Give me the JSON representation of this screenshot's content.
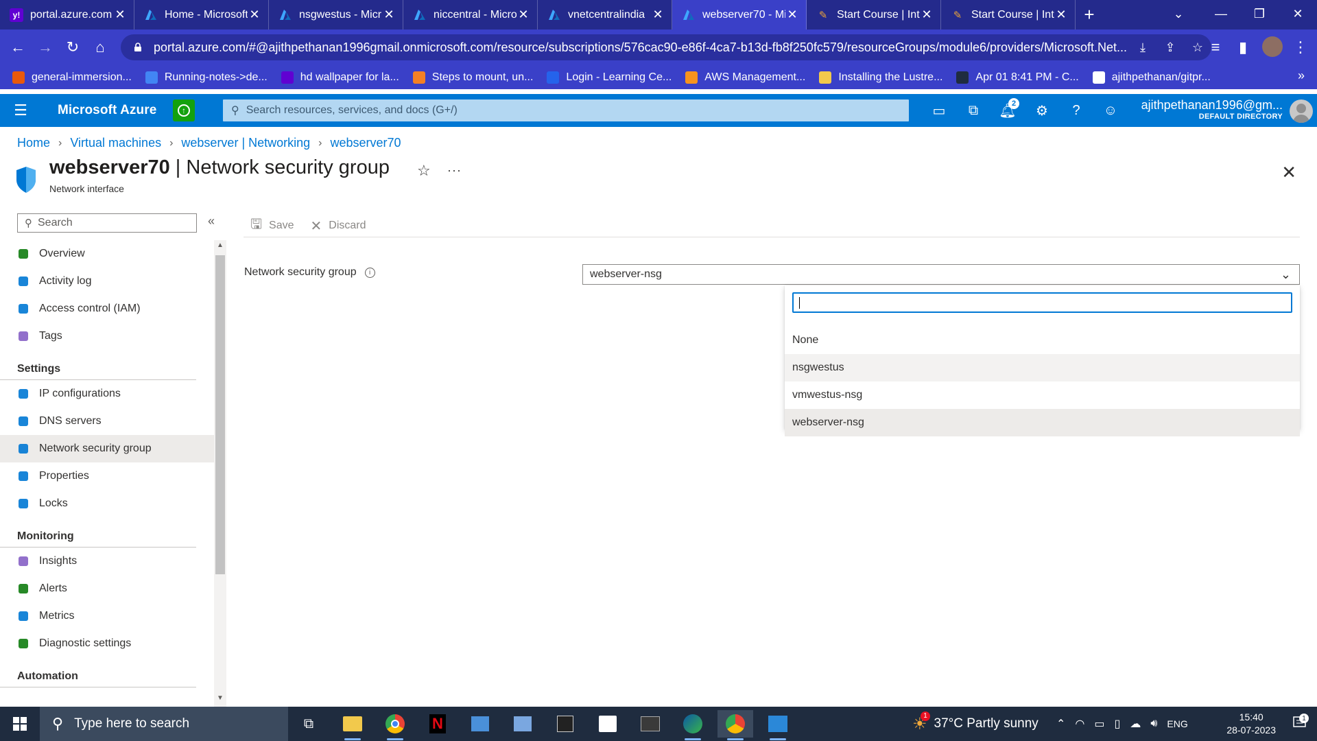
{
  "browser": {
    "tabs": [
      {
        "title": "portal.azure.com",
        "icon": "yahoo-icon",
        "active": false
      },
      {
        "title": "Home - Microsoft",
        "icon": "azure-icon",
        "active": false
      },
      {
        "title": "nsgwestus - Micr",
        "icon": "azure-icon",
        "active": false
      },
      {
        "title": "niccentral - Micro",
        "icon": "azure-icon",
        "active": false
      },
      {
        "title": "vnetcentralindia",
        "icon": "azure-icon",
        "active": false
      },
      {
        "title": "webserver70 - Mi",
        "icon": "azure-icon",
        "active": true
      },
      {
        "title": "Start Course | Inte",
        "icon": "course-icon",
        "active": false
      },
      {
        "title": "Start Course | Inte",
        "icon": "course-icon",
        "active": false
      }
    ],
    "url": "portal.azure.com/#@ajithpethanan1996gmail.onmicrosoft.com/resource/subscriptions/576cac90-e86f-4ca7-b13d-fb8f250fc579/resourceGroups/module6/providers/Microsoft.Net...",
    "bookmarks": [
      {
        "label": "general-immersion...",
        "color": "#e8590c"
      },
      {
        "label": "Running-notes->de...",
        "color": "#4285f4"
      },
      {
        "label": "hd wallpaper for la...",
        "color": "#6001d2"
      },
      {
        "label": "Steps to mount, un...",
        "color": "#f48024"
      },
      {
        "label": "Login - Learning Ce...",
        "color": "#2563eb"
      },
      {
        "label": "AWS Management...",
        "color": "#f7931e"
      },
      {
        "label": "Installing the Lustre...",
        "color": "#f2c94c"
      },
      {
        "label": "Apr 01 8:41 PM - C...",
        "color": "#1f2c3f"
      },
      {
        "label": "ajithpethanan/gitpr...",
        "color": "#ffffff"
      }
    ]
  },
  "azure": {
    "brand": "Microsoft Azure",
    "search_placeholder": "Search resources, services, and docs (G+/)",
    "notification_count": "2",
    "account_email": "ajithpethanan1996@gm...",
    "account_directory": "DEFAULT DIRECTORY"
  },
  "breadcrumb": [
    "Home",
    "Virtual machines",
    "webserver | Networking",
    "webserver70"
  ],
  "page": {
    "resource_name": "webserver70",
    "blade_title": " | Network security group",
    "subtitle": "Network interface"
  },
  "left_menu": {
    "search_placeholder": "Search",
    "items": [
      {
        "type": "item",
        "label": "Overview",
        "icon": "overview-icon",
        "color": "#107c10"
      },
      {
        "type": "item",
        "label": "Activity log",
        "icon": "activity-log-icon",
        "color": "#0078d4"
      },
      {
        "type": "item",
        "label": "Access control (IAM)",
        "icon": "iam-icon",
        "color": "#0078d4"
      },
      {
        "type": "item",
        "label": "Tags",
        "icon": "tags-icon",
        "color": "#8661c5"
      },
      {
        "type": "header",
        "label": "Settings"
      },
      {
        "type": "item",
        "label": "IP configurations",
        "icon": "ip-config-icon",
        "color": "#0078d4"
      },
      {
        "type": "item",
        "label": "DNS servers",
        "icon": "dns-icon",
        "color": "#0078d4"
      },
      {
        "type": "item",
        "label": "Network security group",
        "icon": "nsg-shield-icon",
        "color": "#0078d4",
        "active": true
      },
      {
        "type": "item",
        "label": "Properties",
        "icon": "properties-icon",
        "color": "#0078d4"
      },
      {
        "type": "item",
        "label": "Locks",
        "icon": "lock-icon",
        "color": "#0078d4"
      },
      {
        "type": "header",
        "label": "Monitoring"
      },
      {
        "type": "item",
        "label": "Insights",
        "icon": "insights-icon",
        "color": "#8661c5"
      },
      {
        "type": "item",
        "label": "Alerts",
        "icon": "alerts-icon",
        "color": "#107c10"
      },
      {
        "type": "item",
        "label": "Metrics",
        "icon": "metrics-icon",
        "color": "#0078d4"
      },
      {
        "type": "item",
        "label": "Diagnostic settings",
        "icon": "diagnostic-icon",
        "color": "#107c10"
      },
      {
        "type": "header",
        "label": "Automation"
      }
    ]
  },
  "toolbar": {
    "save_label": "Save",
    "discard_label": "Discard"
  },
  "form": {
    "field_label": "Network security group",
    "selected_value": "webserver-nsg",
    "filter_value": "",
    "options": [
      {
        "label": "None",
        "state": "normal"
      },
      {
        "label": "nsgwestus",
        "state": "hover"
      },
      {
        "label": "vmwestus-nsg",
        "state": "normal"
      },
      {
        "label": "webserver-nsg",
        "state": "selected"
      }
    ]
  },
  "taskbar": {
    "search_placeholder": "Type here to search",
    "weather": "37°C  Partly sunny",
    "weather_badge": "1",
    "language": "ENG",
    "time": "15:40",
    "date": "28-07-2023",
    "notification_count": "1"
  }
}
